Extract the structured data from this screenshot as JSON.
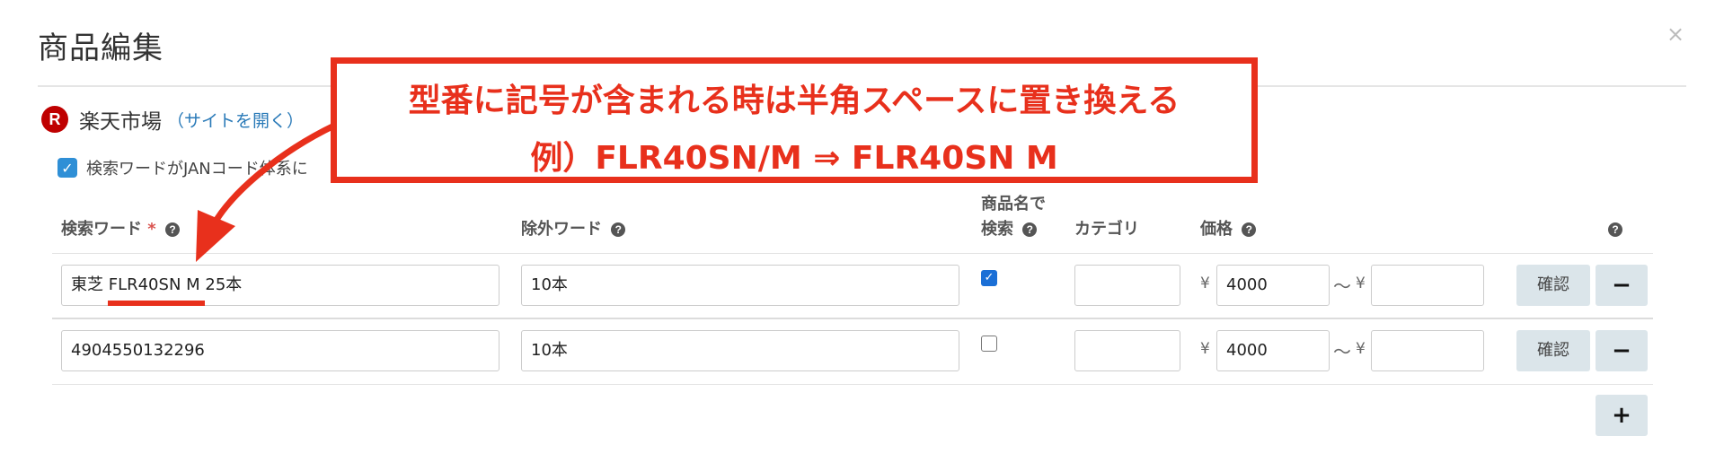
{
  "modal": {
    "title": "商品編集",
    "close_icon": "×"
  },
  "shop": {
    "logo_letter": "R",
    "name": "楽天市場",
    "link": "（サイトを開く）"
  },
  "jan_checkbox": {
    "checked": true,
    "label": "検索ワードがJANコード体系に"
  },
  "columns": {
    "search_word": "検索ワード",
    "required_mark": "*",
    "exclude_word": "除外ワード",
    "name_search_line1": "商品名で",
    "name_search_line2": "検索",
    "category": "カテゴリ",
    "price": "価格",
    "help_glyph": "?"
  },
  "rows": [
    {
      "search_word": "東芝 FLR40SN M 25本",
      "exclude_word": "10本",
      "name_search": true,
      "category": "",
      "price_min": "4000",
      "price_max": ""
    },
    {
      "search_word": "4904550132296",
      "exclude_word": "10本",
      "name_search": false,
      "category": "",
      "price_min": "4000",
      "price_max": ""
    }
  ],
  "labels": {
    "yen": "¥",
    "tilde": "〜",
    "confirm": "確認",
    "remove": "−",
    "add": "+"
  },
  "annotation": {
    "line1": "型番に記号が含まれる時は半角スペースに置き換える",
    "line2": "例）FLR40SN/M ⇒ FLR40SN M",
    "color": "#e8301c"
  }
}
